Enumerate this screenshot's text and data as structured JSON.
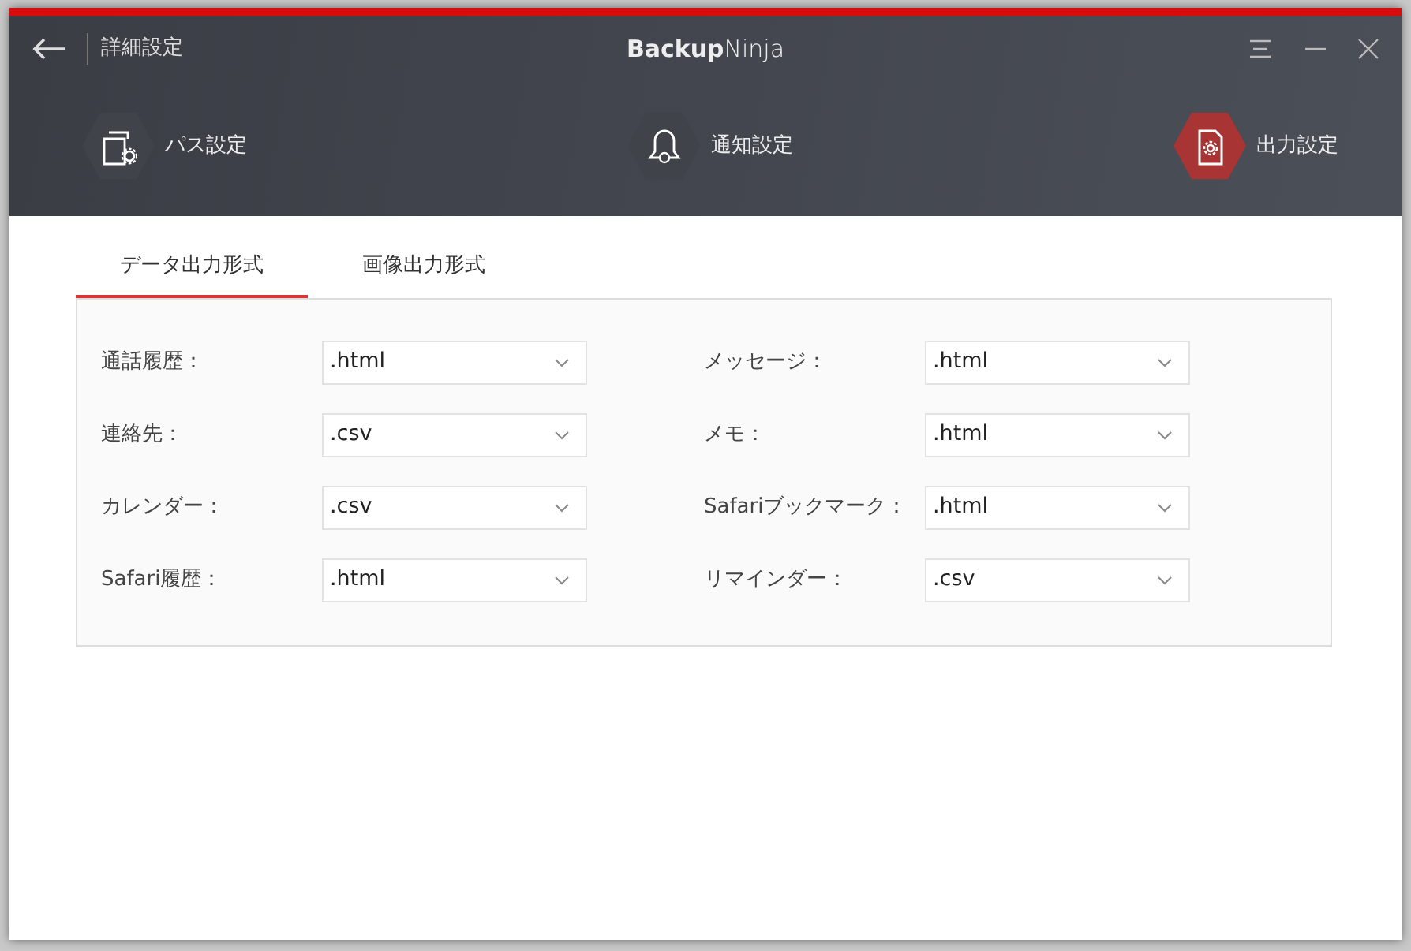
{
  "window": {
    "title": "詳細設定",
    "brand": "**Backup**Ninja"
  },
  "sections": [
    {
      "label": "パス設定",
      "selected": false
    },
    {
      "label": "通知設定",
      "selected": false
    },
    {
      "label": "出力設定",
      "selected": true
    }
  ],
  "tabs": [
    {
      "label": "データ出力形式",
      "selected": true
    },
    {
      "label": "画像出力形式",
      "selected": false
    }
  ],
  "fields": [
    {
      "label": "通話履歴：",
      "value": ".html"
    },
    {
      "label": "メッセージ：",
      "value": ".html"
    },
    {
      "label": "連絡先：",
      "value": ".csv"
    },
    {
      "label": "メモ：",
      "value": ".html"
    },
    {
      "label": "カレンダー：",
      "value": ".csv"
    },
    {
      "label": "Safariブックマーク：",
      "value": ".html"
    },
    {
      "label": "Safari履歴：",
      "value": ".html"
    },
    {
      "label": "リマインダー：",
      "value": ".csv"
    }
  ]
}
